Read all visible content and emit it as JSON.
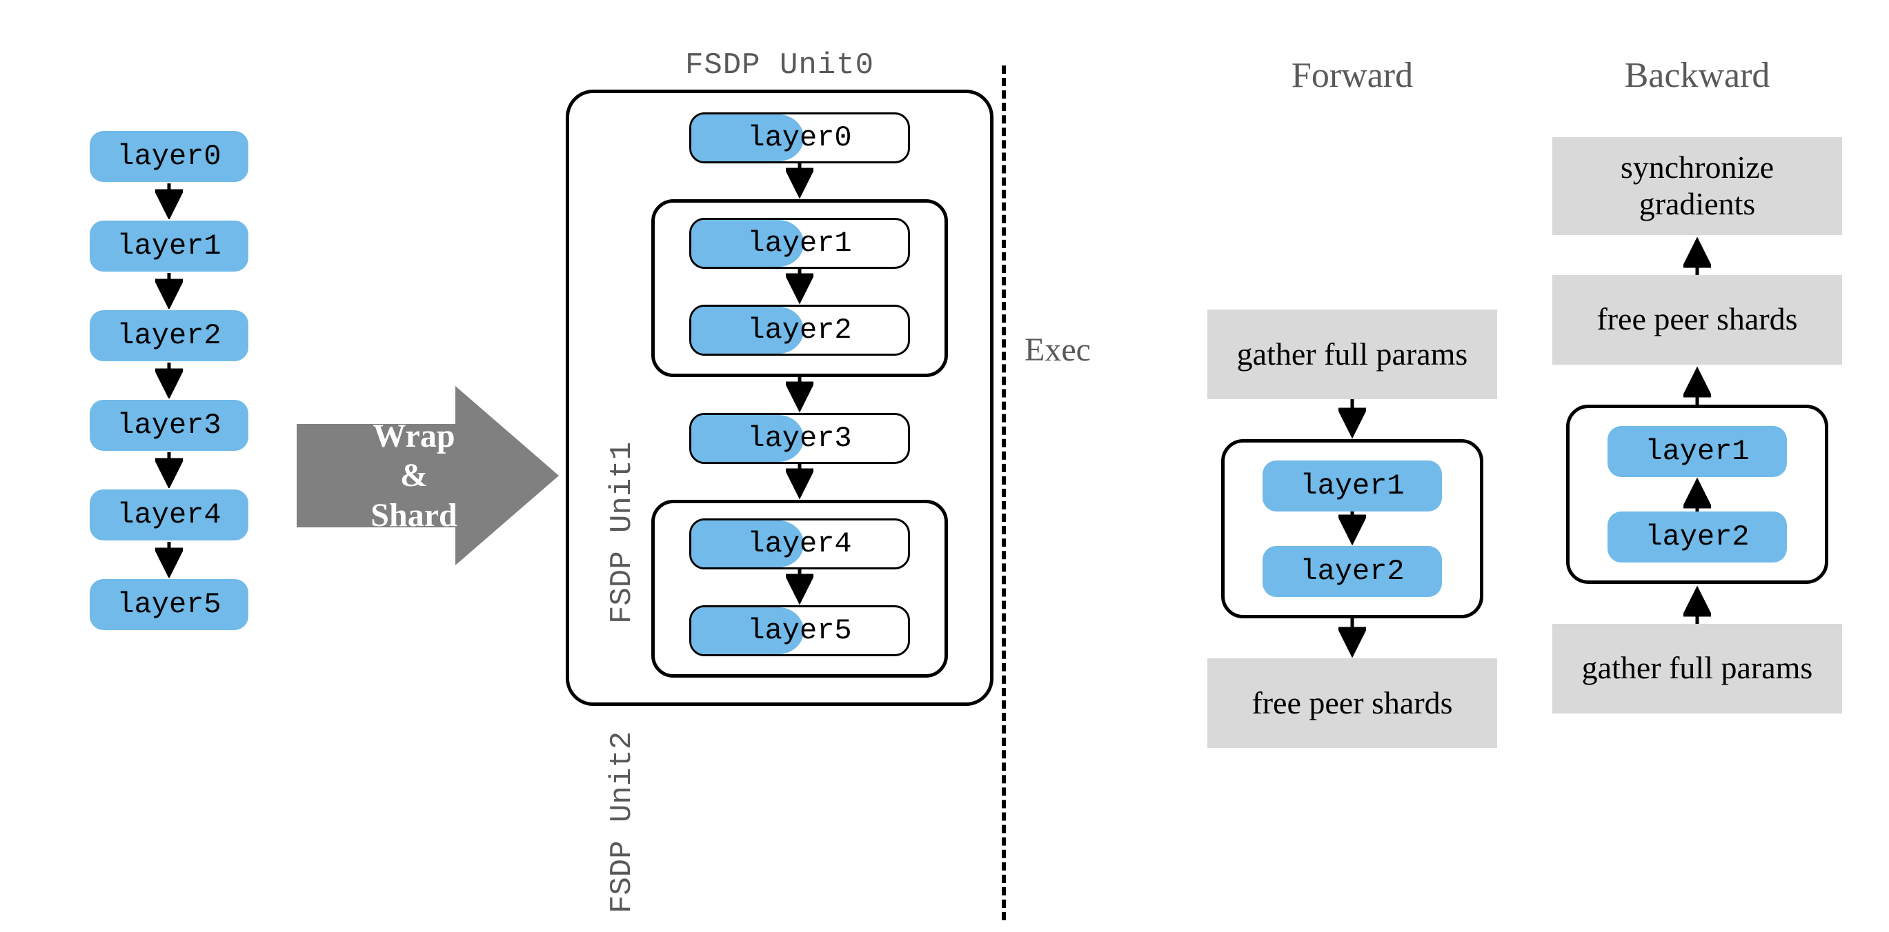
{
  "layers": [
    "layer0",
    "layer1",
    "layer2",
    "layer3",
    "layer4",
    "layer5"
  ],
  "big_arrow": {
    "line1": "Wrap",
    "amp": "&",
    "line2": "Shard"
  },
  "fsdp": {
    "unit0_label": "FSDP Unit0",
    "unit1_label": "FSDP Unit1",
    "unit2_label": "FSDP Unit2",
    "unit0_layers": [
      "layer0",
      "layer3"
    ],
    "unit1_layers": [
      "layer1",
      "layer2"
    ],
    "unit2_layers": [
      "layer4",
      "layer5"
    ]
  },
  "exec_label": "Exec",
  "forward": {
    "title": "Forward",
    "gather": "gather full params",
    "free": "free peer shards",
    "layers": [
      "layer1",
      "layer2"
    ]
  },
  "backward": {
    "title": "Backward",
    "sync": "synchronize gradients",
    "free": "free peer shards",
    "gather": "gather full params",
    "layers": [
      "layer1",
      "layer2"
    ]
  },
  "colors": {
    "layer_blue": "#71bae9",
    "grey_block": "#d9d9d9",
    "text_grey": "#595959",
    "arrow_grey": "#808080"
  }
}
